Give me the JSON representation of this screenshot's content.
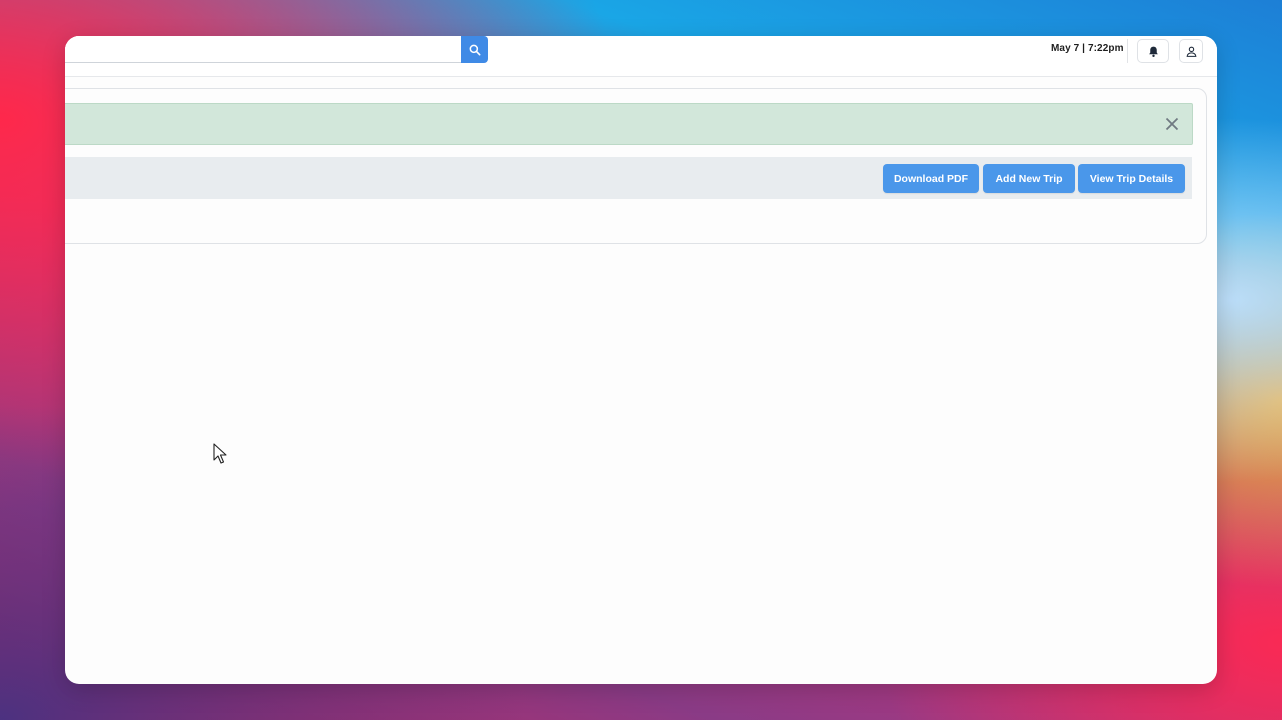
{
  "topbar": {
    "search": {
      "value": "",
      "placeholder": ""
    },
    "datetime": "May 7 | 7:22pm"
  },
  "alert": {
    "close_icon": "close-icon"
  },
  "toolbar": {
    "buttons": [
      {
        "label": "Download PDF"
      },
      {
        "label": "Add New Trip"
      },
      {
        "label": "View Trip Details"
      }
    ]
  },
  "colors": {
    "accent": "#4a97ea",
    "alert_bg": "#d2e7da",
    "toolbar_bg": "#e8ecef"
  }
}
